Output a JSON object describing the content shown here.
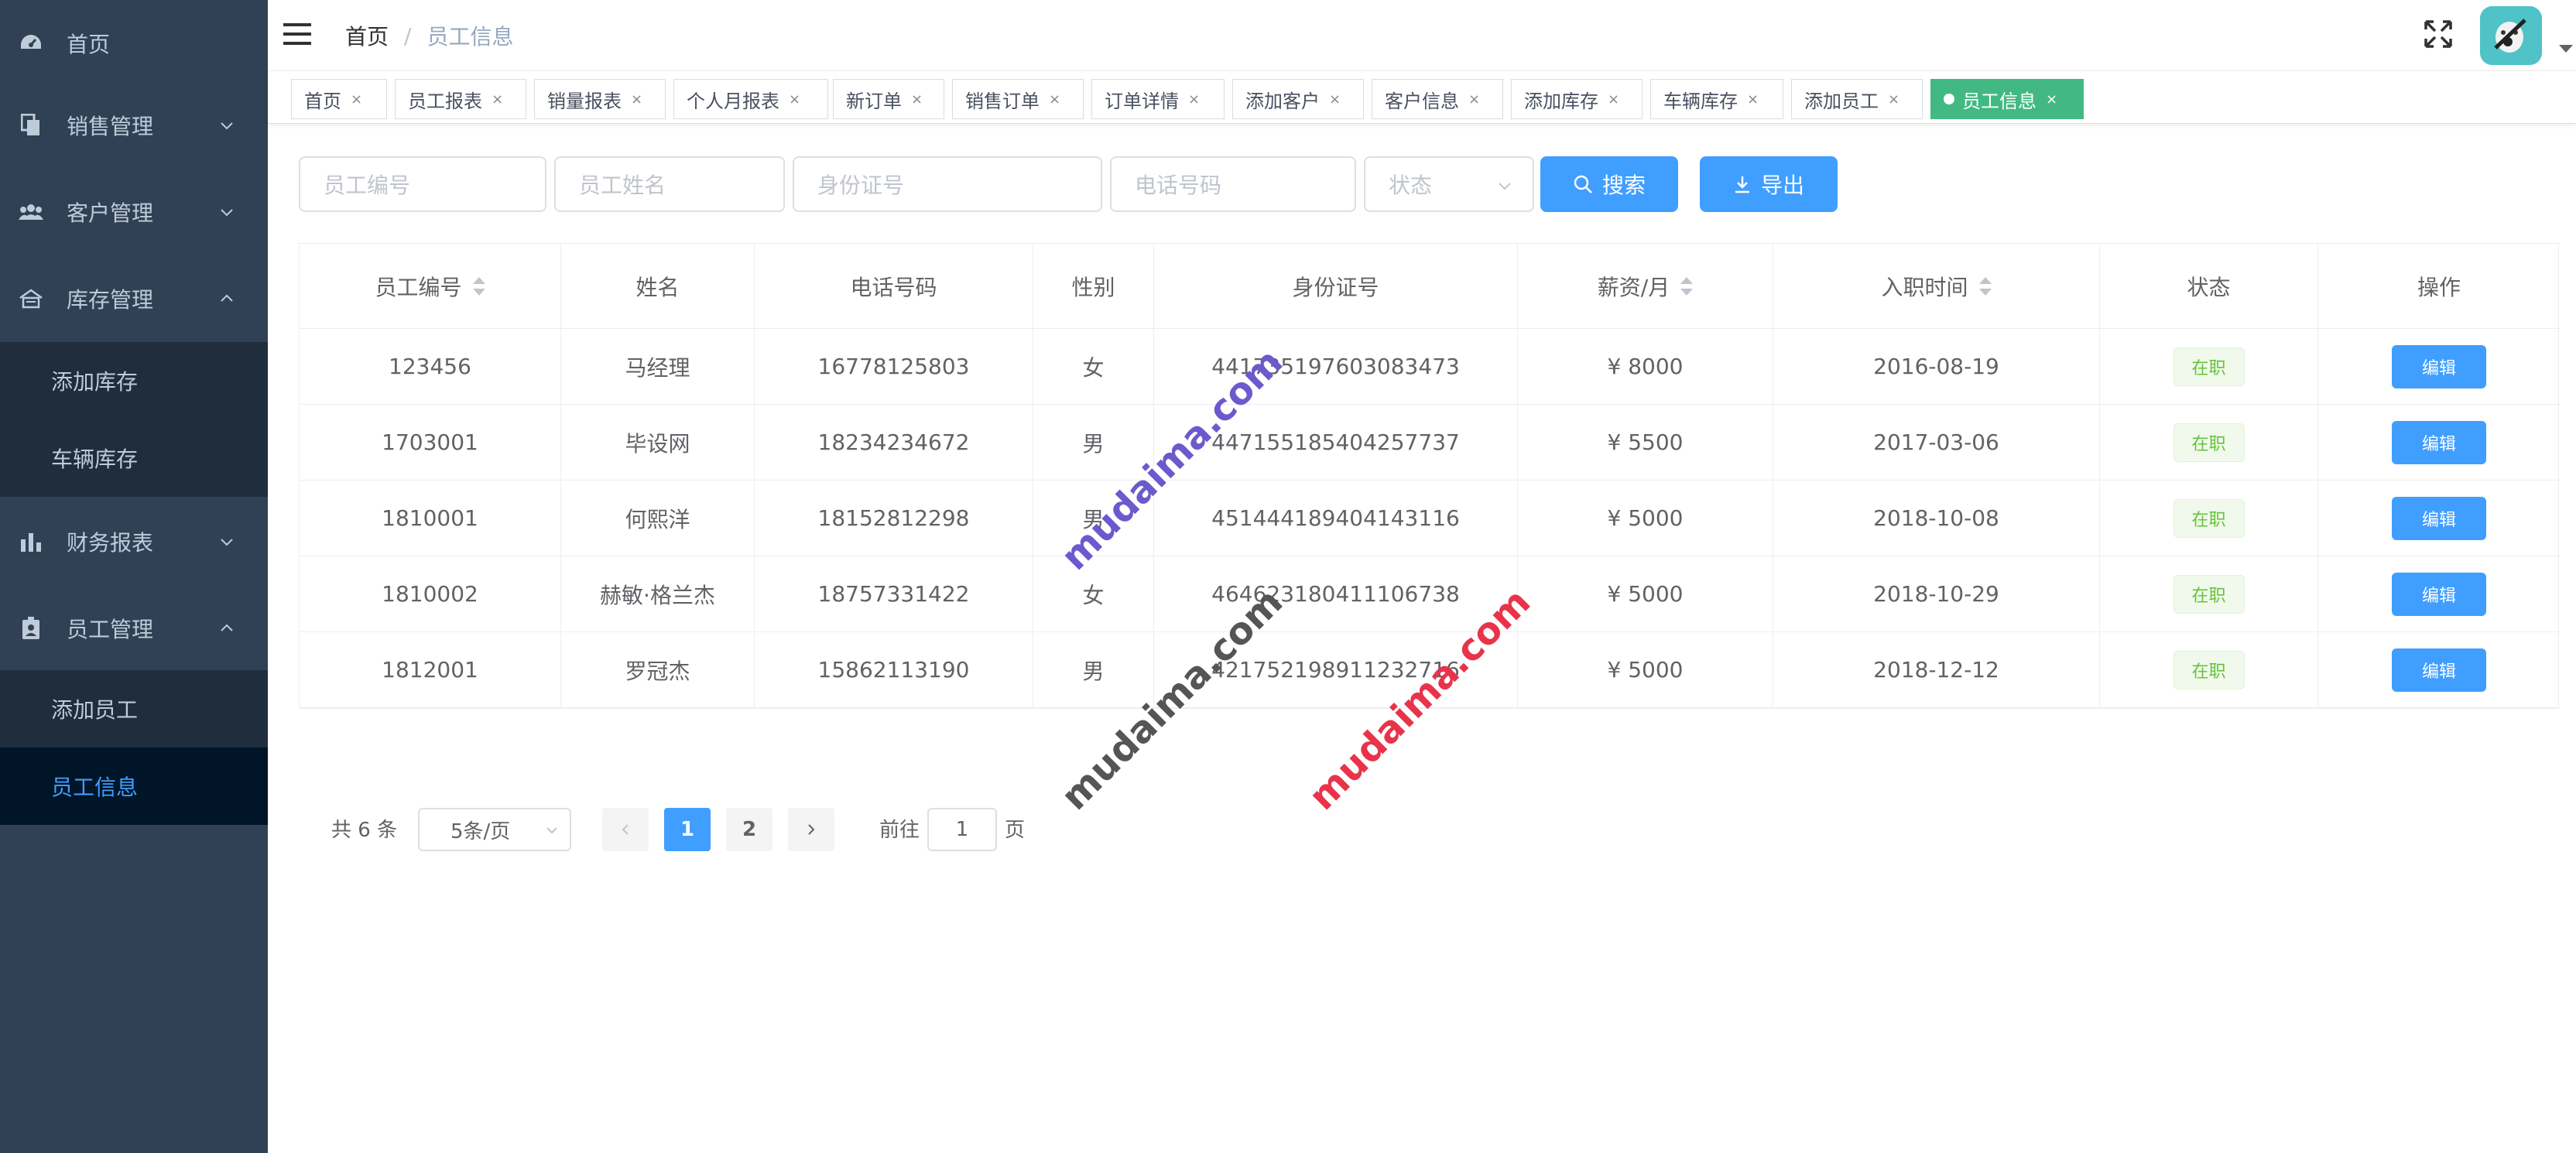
{
  "sidebar": {
    "items": [
      {
        "label": "首页",
        "icon": "dashboard-icon"
      },
      {
        "label": "销售管理",
        "icon": "copy-icon"
      },
      {
        "label": "客户管理",
        "icon": "people-icon"
      },
      {
        "label": "库存管理",
        "icon": "warehouse-icon"
      },
      {
        "label": "财务报表",
        "icon": "chart-icon"
      },
      {
        "label": "员工管理",
        "icon": "badge-icon"
      }
    ],
    "inventory_sub": [
      "添加库存",
      "车辆库存"
    ],
    "employee_sub": [
      "添加员工",
      "员工信息"
    ]
  },
  "navbar": {
    "breadcrumb_home": "首页",
    "breadcrumb_sep": "/",
    "breadcrumb_current": "员工信息"
  },
  "tags": [
    "首页",
    "员工报表",
    "销量报表",
    "个人月报表",
    "新订单",
    "销售订单",
    "订单详情",
    "添加客户",
    "客户信息",
    "添加库存",
    "车辆库存",
    "添加员工",
    "员工信息"
  ],
  "tag_close": "×",
  "filter": {
    "emp_no_placeholder": "员工编号",
    "name_placeholder": "员工姓名",
    "id_placeholder": "身份证号",
    "phone_placeholder": "电话号码",
    "status_placeholder": "状态",
    "search_label": "搜索",
    "export_label": "导出"
  },
  "table": {
    "columns": [
      "员工编号",
      "姓名",
      "电话号码",
      "性别",
      "身份证号",
      "薪资/月",
      "入职时间",
      "状态",
      "操作"
    ],
    "rows": [
      {
        "emp_no": "123456",
        "name": "马经理",
        "phone": "16778125803",
        "gender": "女",
        "id_no": "441735197603083473",
        "salary": "¥ 8000",
        "hire_date": "2016-08-19",
        "status": "在职",
        "action": "编辑"
      },
      {
        "emp_no": "1703001",
        "name": "毕设网",
        "phone": "18234234672",
        "gender": "男",
        "id_no": "447155185404257737",
        "salary": "¥ 5500",
        "hire_date": "2017-03-06",
        "status": "在职",
        "action": "编辑"
      },
      {
        "emp_no": "1810001",
        "name": "何熙洋",
        "phone": "18152812298",
        "gender": "男",
        "id_no": "451444189404143116",
        "salary": "¥ 5000",
        "hire_date": "2018-10-08",
        "status": "在职",
        "action": "编辑"
      },
      {
        "emp_no": "1810002",
        "name": "赫敏·格兰杰",
        "phone": "18757331422",
        "gender": "女",
        "id_no": "464623180411106738",
        "salary": "¥ 5000",
        "hire_date": "2018-10-29",
        "status": "在职",
        "action": "编辑"
      },
      {
        "emp_no": "1812001",
        "name": "罗冠杰",
        "phone": "15862113190",
        "gender": "男",
        "id_no": "421752198911232716",
        "salary": "¥ 5000",
        "hire_date": "2018-12-12",
        "status": "在职",
        "action": "编辑"
      }
    ]
  },
  "pagination": {
    "total": "共 6 条",
    "page_size": "5条/页",
    "pages": [
      "1",
      "2"
    ],
    "goto_label": "前往",
    "goto_value": "1",
    "page_unit": "页"
  },
  "watermark": {
    "text": "mudaima.com",
    "colors": [
      "#6a5acd",
      "#555555",
      "#e8334a"
    ]
  }
}
